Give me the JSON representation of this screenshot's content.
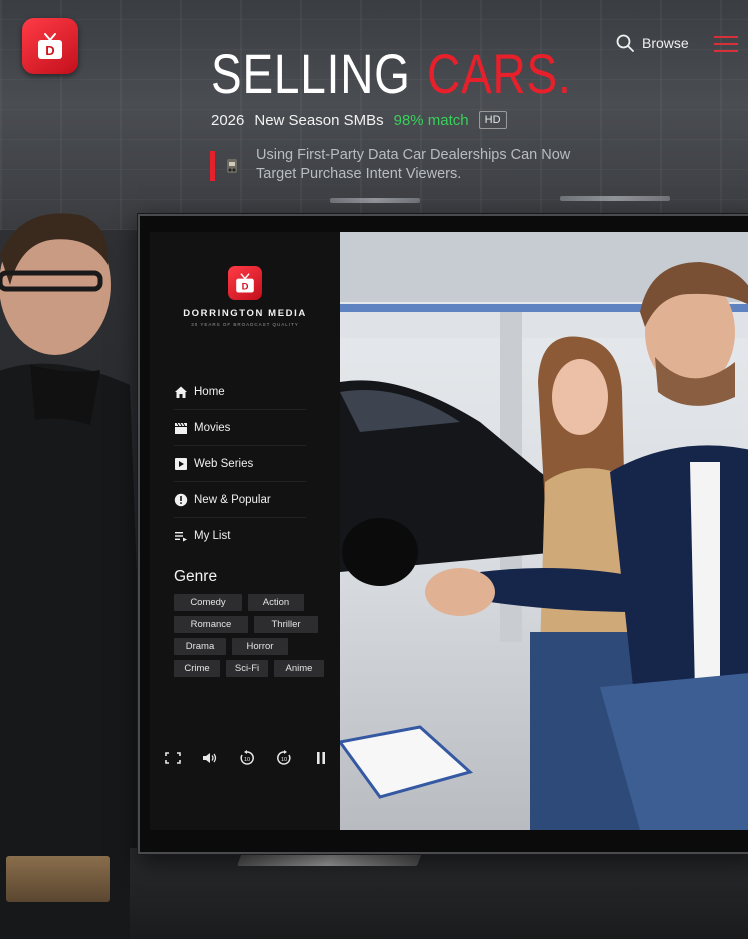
{
  "header": {
    "app_logo_letter": "D",
    "browse_label": "Browse"
  },
  "hero": {
    "title_word1": "SELLING",
    "title_word2": "CARS.",
    "year": "2026",
    "season": "New Season SMBs",
    "match": "98% match",
    "quality_badge": "HD",
    "description": "Using First-Party Data Car Dealerships Can Now Target Purchase Intent Viewers."
  },
  "tv": {
    "brand_logo_letter": "D",
    "brand_name": "DORRINGTON MEDIA",
    "brand_tagline": "30 YEARS OF BROADCAST QUALITY",
    "nav": [
      {
        "label": "Home",
        "icon": "home-icon"
      },
      {
        "label": "Movies",
        "icon": "clapperboard-icon"
      },
      {
        "label": "Web Series",
        "icon": "play-square-icon"
      },
      {
        "label": "New & Popular",
        "icon": "alert-circle-icon"
      },
      {
        "label": "My List",
        "icon": "list-icon"
      }
    ],
    "genre_title": "Genre",
    "genres": [
      [
        "Comedy",
        "Action"
      ],
      [
        "Romance",
        "Thriller"
      ],
      [
        "Drama",
        "Horror"
      ],
      [
        "Crime",
        "Sci-Fi",
        "Anime"
      ]
    ],
    "controls": [
      "fullscreen-icon",
      "volume-icon",
      "rewind-10-icon",
      "forward-10-icon",
      "pause-icon"
    ]
  },
  "colors": {
    "accent_red": "#e8202c",
    "match_green": "#38d15a",
    "sidebar_bg": "#121213",
    "chip_bg": "#2d2d2f"
  }
}
